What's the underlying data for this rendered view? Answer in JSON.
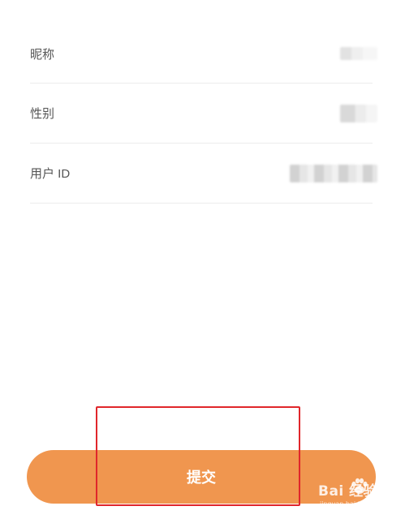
{
  "profile": {
    "fields": [
      {
        "label": "昵称",
        "value_icon": "blurred-value"
      },
      {
        "label": "性别",
        "value_icon": "blurred-value"
      },
      {
        "label": "用户 ID",
        "value_icon": "blurred-value"
      }
    ]
  },
  "submit": {
    "label": "提交"
  },
  "annotation": {
    "color": "#e0262b"
  },
  "watermark": {
    "brand": "Bai 经验",
    "url": "jingyan.baidu.com"
  },
  "colors": {
    "accent": "#f0964f",
    "divider": "#ececec",
    "label": "#555555"
  }
}
